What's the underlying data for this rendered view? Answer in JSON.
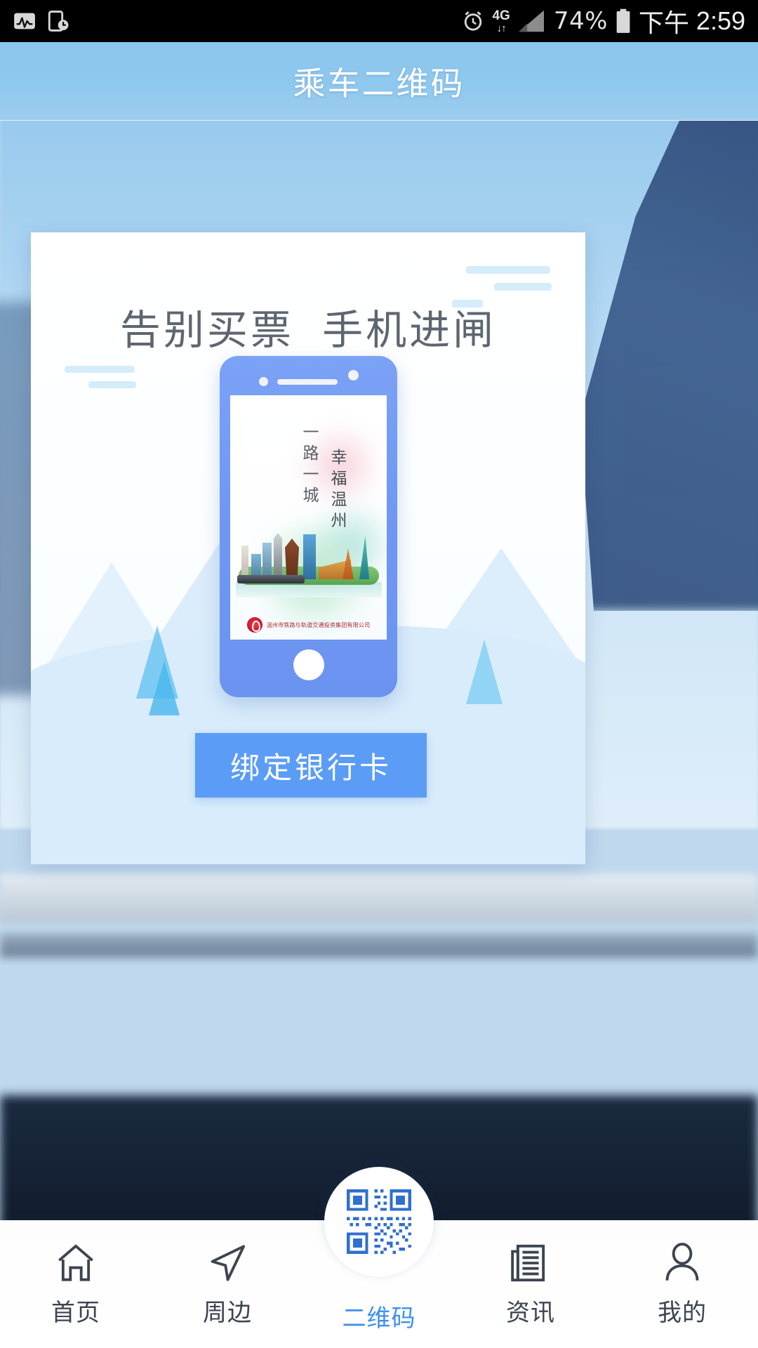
{
  "status_bar": {
    "left_icons": [
      {
        "name": "activity-monitor-icon",
        "label": "活动"
      },
      {
        "name": "screen-time-icon",
        "label": "屏幕时间"
      }
    ],
    "alarm_icon": "alarm-clock-icon",
    "network_type": "4G",
    "network_arrows": "↓↑",
    "signal_icon": "signal-bars-icon",
    "battery_percent": "74%",
    "battery_icon": "battery-icon",
    "time_period": "下午",
    "time": "2:59"
  },
  "header": {
    "title": "乘车二维码"
  },
  "card": {
    "headline": "告别买票  手机进闸",
    "poster": {
      "column_right": "一路一城",
      "column_left": "幸福温州",
      "company": "温州市铁路与轨道交通投资集团有限公司",
      "logo_name": "wenzhou-rail-logo"
    },
    "bind_button_label": "绑定银行卡"
  },
  "bottom_nav": {
    "items": [
      {
        "label": "首页",
        "icon": "home-icon",
        "active": false
      },
      {
        "label": "周边",
        "icon": "navigation-arrow-icon",
        "active": false
      },
      {
        "label": "二维码",
        "icon": "qr-code-icon",
        "active": true
      },
      {
        "label": "资讯",
        "icon": "news-icon",
        "active": false
      },
      {
        "label": "我的",
        "icon": "person-icon",
        "active": false
      }
    ]
  },
  "colors": {
    "header_blue": "#8fc8ee",
    "button_blue": "#5b9cf6",
    "active_nav": "#3d8ff0",
    "phone_frame": "#6f97f2",
    "logo_red": "#c8102e"
  }
}
